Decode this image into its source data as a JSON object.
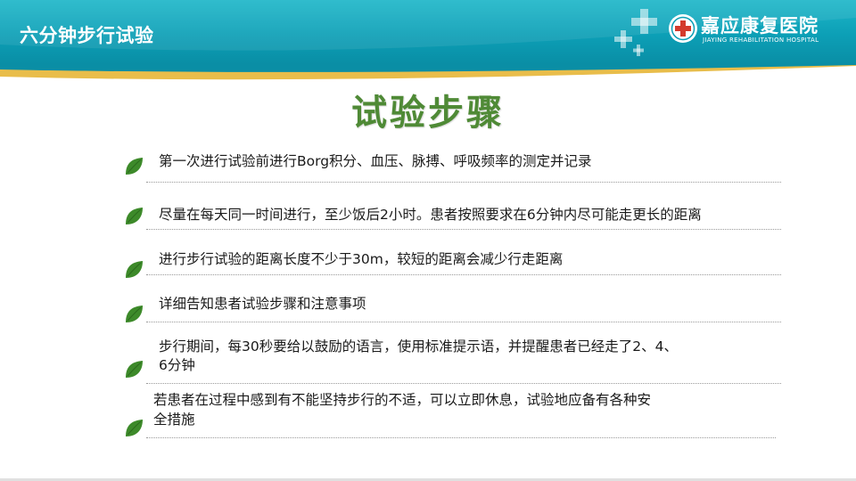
{
  "header": {
    "title": "六分钟步行试验",
    "logo_cn": "嘉应康复医院",
    "logo_en": "JIAYING REHABILITATION HOSPITAL"
  },
  "main_title": "试验步骤",
  "steps": [
    {
      "line1": "第一次进行试验前进行Borg积分、血压、脉搏、呼吸频率的测定并记录",
      "line2": ""
    },
    {
      "line1": "尽量在每天同一时间进行，至少饭后2小时。患者按照要求在6分钟内尽可能走更长的距离",
      "line2": ""
    },
    {
      "line1": "进行步行试验的距离长度不少于30m，较短的距离会减少行走距离",
      "line2": ""
    },
    {
      "line1": "详细告知患者试验步骤和注意事项",
      "line2": ""
    },
    {
      "line1": "步行期间，每30秒要给以鼓励的语言，使用标准提示语，并提醒患者已经走了2、4、",
      "line2": "6分钟"
    },
    {
      "line1": "若患者在过程中感到有不能坚持步行的不适，可以立即休息，试验地应备有各种安",
      "line2": "全措施"
    }
  ],
  "colors": {
    "header": "#0c9fb6",
    "title_green": "#4f8a36",
    "leaf_green": "#3d8a2a"
  },
  "icons": [
    "plus-crosses-icon",
    "hospital-logo-icon",
    "leaf-bullet-icon"
  ]
}
